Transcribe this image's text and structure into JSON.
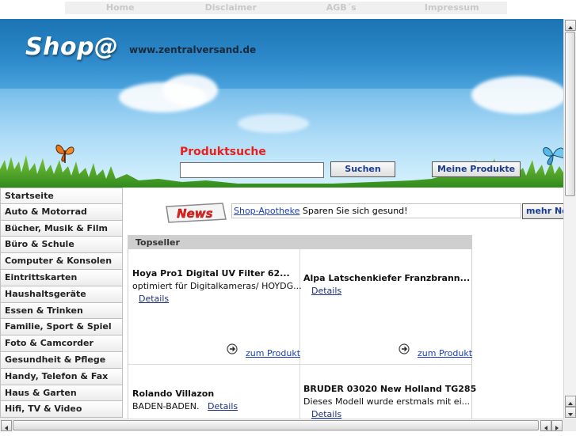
{
  "topnav": {
    "items": [
      "Home",
      "Disclaimer",
      "AGB´s",
      "Impressum"
    ]
  },
  "banner": {
    "logo": "Shop@",
    "url": "www.zentralversand.de"
  },
  "search": {
    "label": "Produktsuche",
    "placeholder": "",
    "button_label": "Suchen",
    "my_products_label": "Meine Produkte"
  },
  "sidebar": {
    "items": [
      "Startseite",
      "Auto & Motorrad",
      "Bücher, Musik & Film",
      "Büro & Schule",
      "Computer & Konsolen",
      "Eintrittskarten",
      "Haushaltsgeräte",
      "Essen & Trinken",
      "Familie, Sport & Spiel",
      "Foto & Camcorder",
      "Gesundheit & Pflege",
      "Handy, Telefon & Fax",
      "Haus & Garten",
      "Hifi, TV & Video"
    ]
  },
  "news": {
    "badge": "News",
    "link_text": "Shop-Apotheke",
    "text": " Sparen Sie sich gesund!",
    "more_label": "mehr News"
  },
  "topseller": {
    "header": "Topseller",
    "details_label": "Details",
    "product_link_label": "zum Produkt",
    "products": [
      {
        "name": "Hoya Pro1 Digital UV Filter 62...",
        "desc": "optimiert für Digitalkameras/ HOYDG..."
      },
      {
        "name": "Alpa Latschenkiefer Franzbrann...",
        "desc": ""
      },
      {
        "name": "Rolando Villazon",
        "desc": "BADEN-BADEN."
      },
      {
        "name": "BRUDER 03020 New Holland TG285",
        "desc": "Dieses Modell wurde erstmals mit ei..."
      }
    ]
  },
  "colors": {
    "accent_red": "#e8201c",
    "link_blue": "#1d3fb6",
    "sky_blue": "#1f7fbf"
  }
}
